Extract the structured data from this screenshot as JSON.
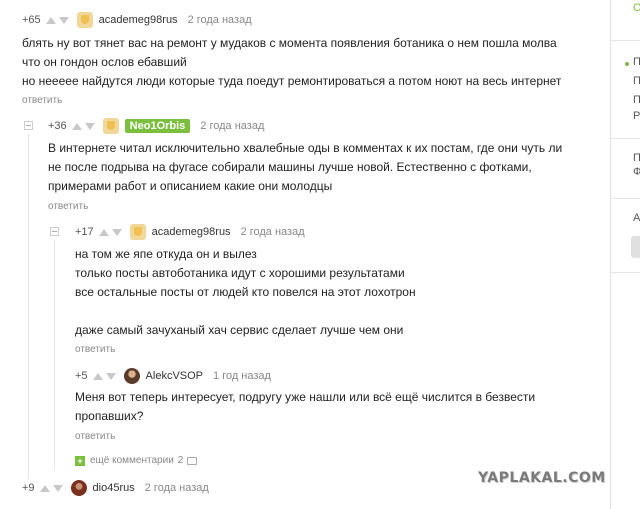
{
  "comments": {
    "c1": {
      "rating": "+65",
      "username": "academeg98rus",
      "time": "2 года назад",
      "lines": [
        "блять ну вот тянет вас на ремонт у мудаков с момента появления ботаника о нем пошла молва",
        "что он гондон ослов ебавший",
        "но нееeee найдутся люди  которые  туда поедут ремонтироваться  а потом ноют на весь интернет"
      ],
      "reply": "ответить"
    },
    "c2": {
      "rating": "+36",
      "username": "Neo1Orbis",
      "time": "2 года назад",
      "lines": [
        "В интернете читал исключительно хвалебные оды в комментах к их постам, где они чуть ли",
        "не после подрыва на фугасе собирали машины лучше новой. Естественно с фотками,",
        "примерами работ и описанием какие они молодцы"
      ],
      "reply": "ответить"
    },
    "c3": {
      "rating": "+17",
      "username": "academeg98rus",
      "time": "2 года назад",
      "lines": [
        "на том же япе откуда он и вылез",
        "только посты автоботаника  идут с хорошими результатами",
        "все остальные посты от людей кто повелся на этот лохотрон",
        "",
        "даже самый зачуханый хач сервис сделает лучше чем они"
      ],
      "reply": "ответить"
    },
    "c4": {
      "rating": "+5",
      "username": "AlekcVSOP",
      "time": "1 год назад",
      "lines": [
        "Меня вот теперь интересует, подругу уже нашли или всё ещё числится в безвести",
        "пропавших?"
      ],
      "reply": "ответить"
    },
    "more": {
      "label": "ещё комментарии",
      "count": "2"
    },
    "c5": {
      "rating": "+9",
      "username": "dio45rus",
      "time": "2 года назад"
    }
  },
  "sidebar": {
    "letters": [
      "О",
      "П",
      "П",
      "Р",
      "П",
      "Ф",
      "А"
    ]
  },
  "watermark": "YAPLAKAL.COM"
}
